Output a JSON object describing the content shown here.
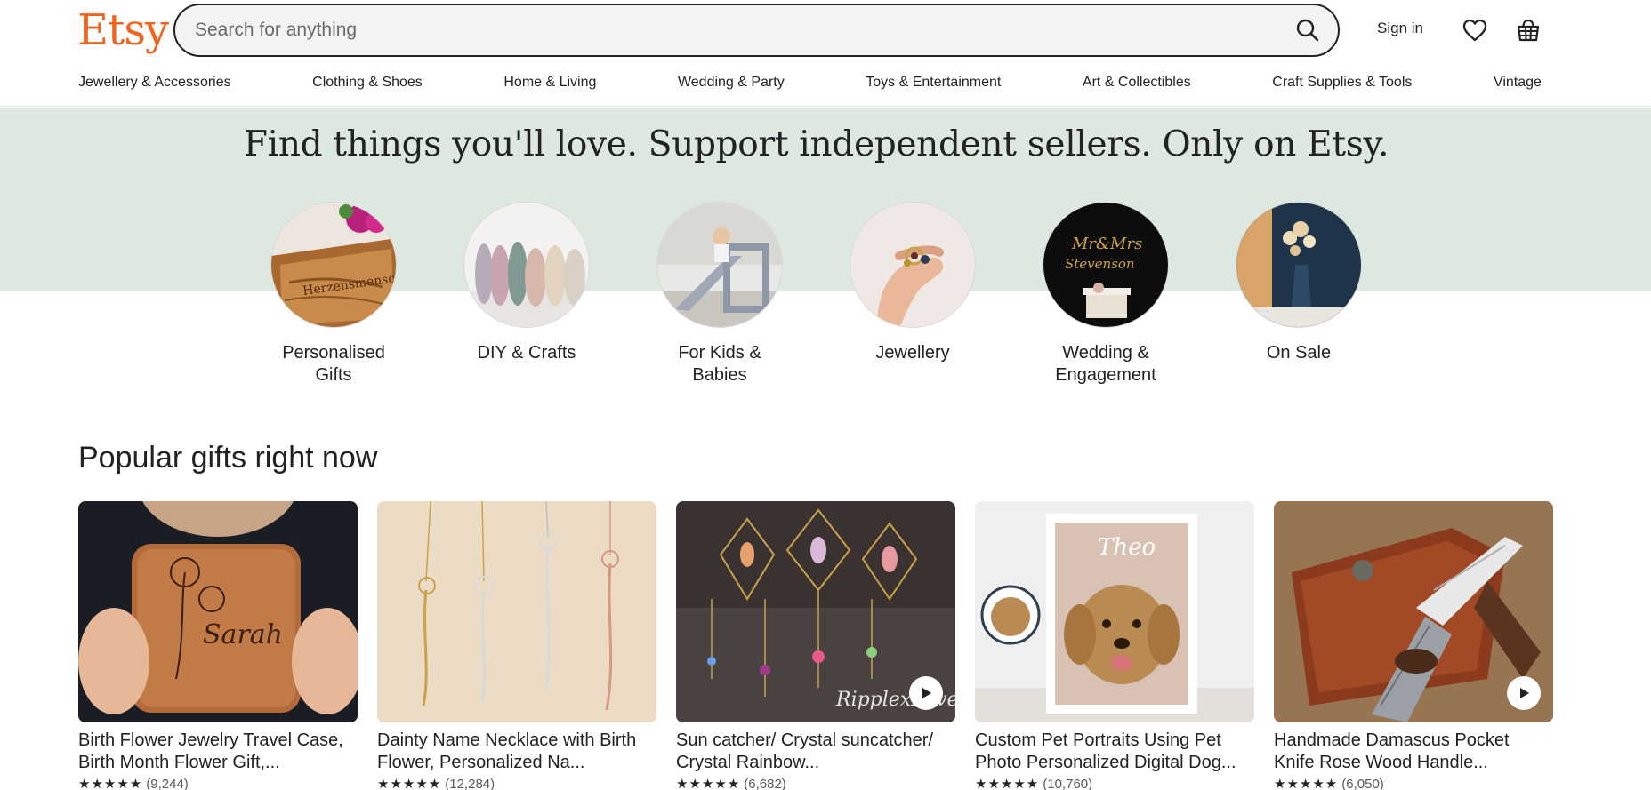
{
  "header": {
    "logo": "Etsy",
    "search_placeholder": "Search for anything",
    "sign_in": "Sign in",
    "favorites_icon": "heart-icon",
    "cart_icon": "basket-icon",
    "search_icon": "search-icon"
  },
  "nav": {
    "items": [
      "Jewellery & Accessories",
      "Clothing & Shoes",
      "Home & Living",
      "Wedding & Party",
      "Toys & Entertainment",
      "Art & Collectibles",
      "Craft Supplies & Tools",
      "Vintage"
    ]
  },
  "hero": {
    "title": "Find things you'll love. Support independent sellers. Only on Etsy.",
    "background": "#dde9e0"
  },
  "categories": [
    {
      "label": "Personalised Gifts"
    },
    {
      "label": "DIY & Crafts"
    },
    {
      "label": "For Kids & Babies"
    },
    {
      "label": "Jewellery"
    },
    {
      "label": "Wedding & Engagement"
    },
    {
      "label": "On Sale"
    }
  ],
  "popular": {
    "title": "Popular gifts right now",
    "items": [
      {
        "title": "Birth Flower Jewelry Travel Case, Birth Month Flower Gift,...",
        "stars": "★★★★★",
        "count": "(9,244)",
        "video": false
      },
      {
        "title": "Dainty Name Necklace with Birth Flower, Personalized Na...",
        "stars": "★★★★★",
        "count": "(12,284)",
        "video": false
      },
      {
        "title": "Sun catcher/ Crystal suncatcher/ Crystal Rainbow...",
        "stars": "★★★★★",
        "count": "(6,682)",
        "video": true
      },
      {
        "title": "Custom Pet Portraits Using Pet Photo Personalized Digital Dog...",
        "stars": "★★★★★",
        "count": "(10,760)",
        "video": false
      },
      {
        "title": "Handmade Damascus Pocket Knife Rose Wood Handle...",
        "stars": "★★★★★",
        "count": "(6,050)",
        "video": true
      }
    ]
  },
  "colors": {
    "brand": "#f1641e",
    "text": "#222222",
    "hero_bg": "#dde9e0"
  }
}
